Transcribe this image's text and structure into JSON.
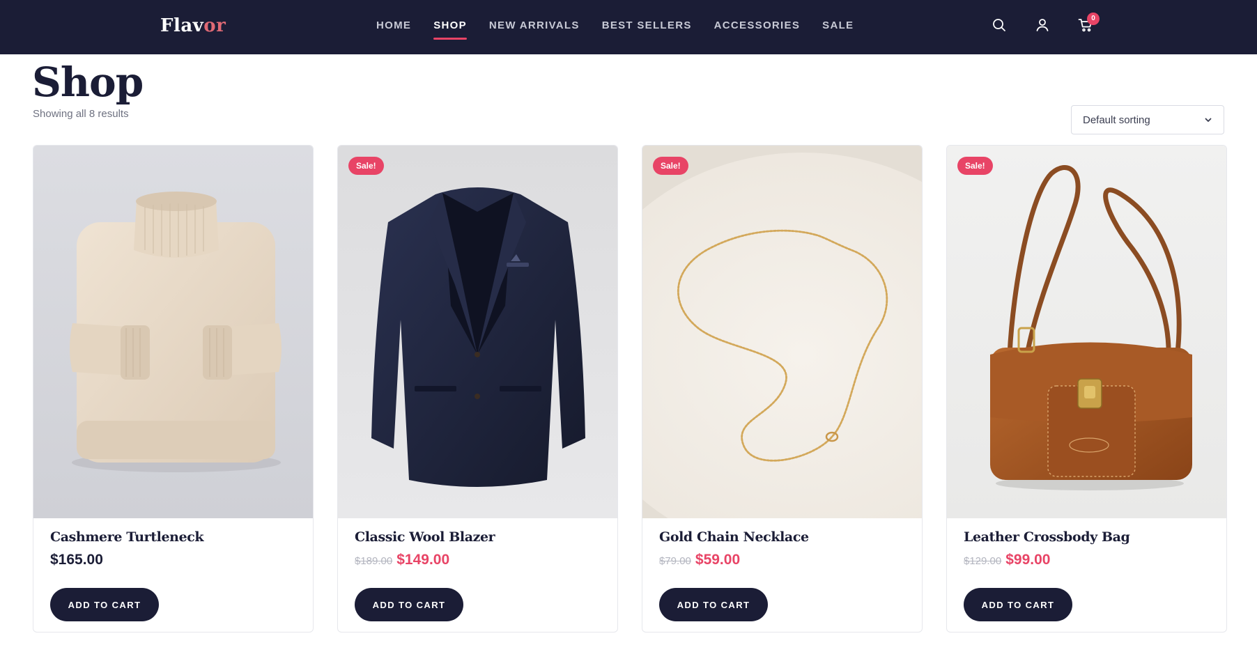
{
  "header": {
    "logo": {
      "main": "Flav",
      "accent": "or"
    },
    "nav": [
      {
        "label": "HOME",
        "active": false
      },
      {
        "label": "SHOP",
        "active": true
      },
      {
        "label": "NEW ARRIVALS",
        "active": false
      },
      {
        "label": "BEST SELLERS",
        "active": false
      },
      {
        "label": "ACCESSORIES",
        "active": false
      },
      {
        "label": "SALE",
        "active": false
      }
    ],
    "icons": [
      "search-icon",
      "user-icon",
      "cart-icon"
    ],
    "cart_count": "0"
  },
  "page": {
    "title": "Shop",
    "result_count": "Showing all 8 results",
    "sort": {
      "selected": "Default sorting"
    }
  },
  "products": [
    {
      "name": "Cashmere Turtleneck",
      "price": "$165.00",
      "old_price": "",
      "on_sale": false,
      "button": "ADD TO CART",
      "image": "beige-turtleneck-sweater"
    },
    {
      "name": "Classic Wool Blazer",
      "price": "$149.00",
      "old_price": "$189.00",
      "on_sale": true,
      "badge": "Sale!",
      "button": "ADD TO CART",
      "image": "navy-wool-blazer"
    },
    {
      "name": "Gold Chain Necklace",
      "price": "$59.00",
      "old_price": "$79.00",
      "on_sale": true,
      "badge": "Sale!",
      "button": "ADD TO CART",
      "image": "gold-chain-necklace-on-plate"
    },
    {
      "name": "Leather Crossbody Bag",
      "price": "$99.00",
      "old_price": "$129.00",
      "on_sale": true,
      "badge": "Sale!",
      "button": "ADD TO CART",
      "image": "brown-leather-crossbody-bag"
    }
  ],
  "colors": {
    "header_bg": "#1b1d36",
    "accent": "#e84466",
    "logo_accent": "#e06a75",
    "button_bg": "#1b1d36"
  }
}
